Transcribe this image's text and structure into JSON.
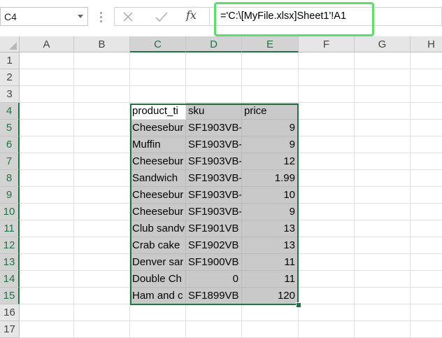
{
  "name_box": {
    "value": "C4"
  },
  "formula_bar": {
    "fx_label": "fx",
    "formula": "='C:\\[MyFile.xlsx]Sheet1'!A1"
  },
  "columns": [
    "A",
    "B",
    "C",
    "D",
    "E",
    "F",
    "G",
    "H"
  ],
  "rows": [
    "1",
    "2",
    "3",
    "4",
    "5",
    "6",
    "7",
    "8",
    "9",
    "10",
    "11",
    "12",
    "13",
    "14",
    "15",
    "16",
    "17"
  ],
  "table": {
    "headers": [
      "product_ti",
      "sku",
      "price"
    ],
    "rows": [
      [
        "Cheesebur",
        "SF1903VB-",
        "9"
      ],
      [
        "Muffin",
        "SF1903VB-",
        "9"
      ],
      [
        "Cheesebur",
        "SF1903VB-",
        "12"
      ],
      [
        "Sandwich",
        "SF1903VB-",
        "1.99"
      ],
      [
        "Cheesebur",
        "SF1903VB-",
        "10"
      ],
      [
        "Cheesebur",
        "SF1903VB-",
        "9"
      ],
      [
        "Club sandv",
        "SF1901VB",
        "13"
      ],
      [
        "Crab cake",
        "SF1902VB",
        "13"
      ],
      [
        "Denver sar",
        "SF1900VB",
        "11"
      ],
      [
        "Double Ch",
        "0",
        "11"
      ],
      [
        "Ham and c",
        "SF1899VB",
        "120"
      ]
    ]
  },
  "colors": {
    "selection": "#217346",
    "highlight": "#5fdc6c",
    "range_fill": "#c9c9c9"
  }
}
